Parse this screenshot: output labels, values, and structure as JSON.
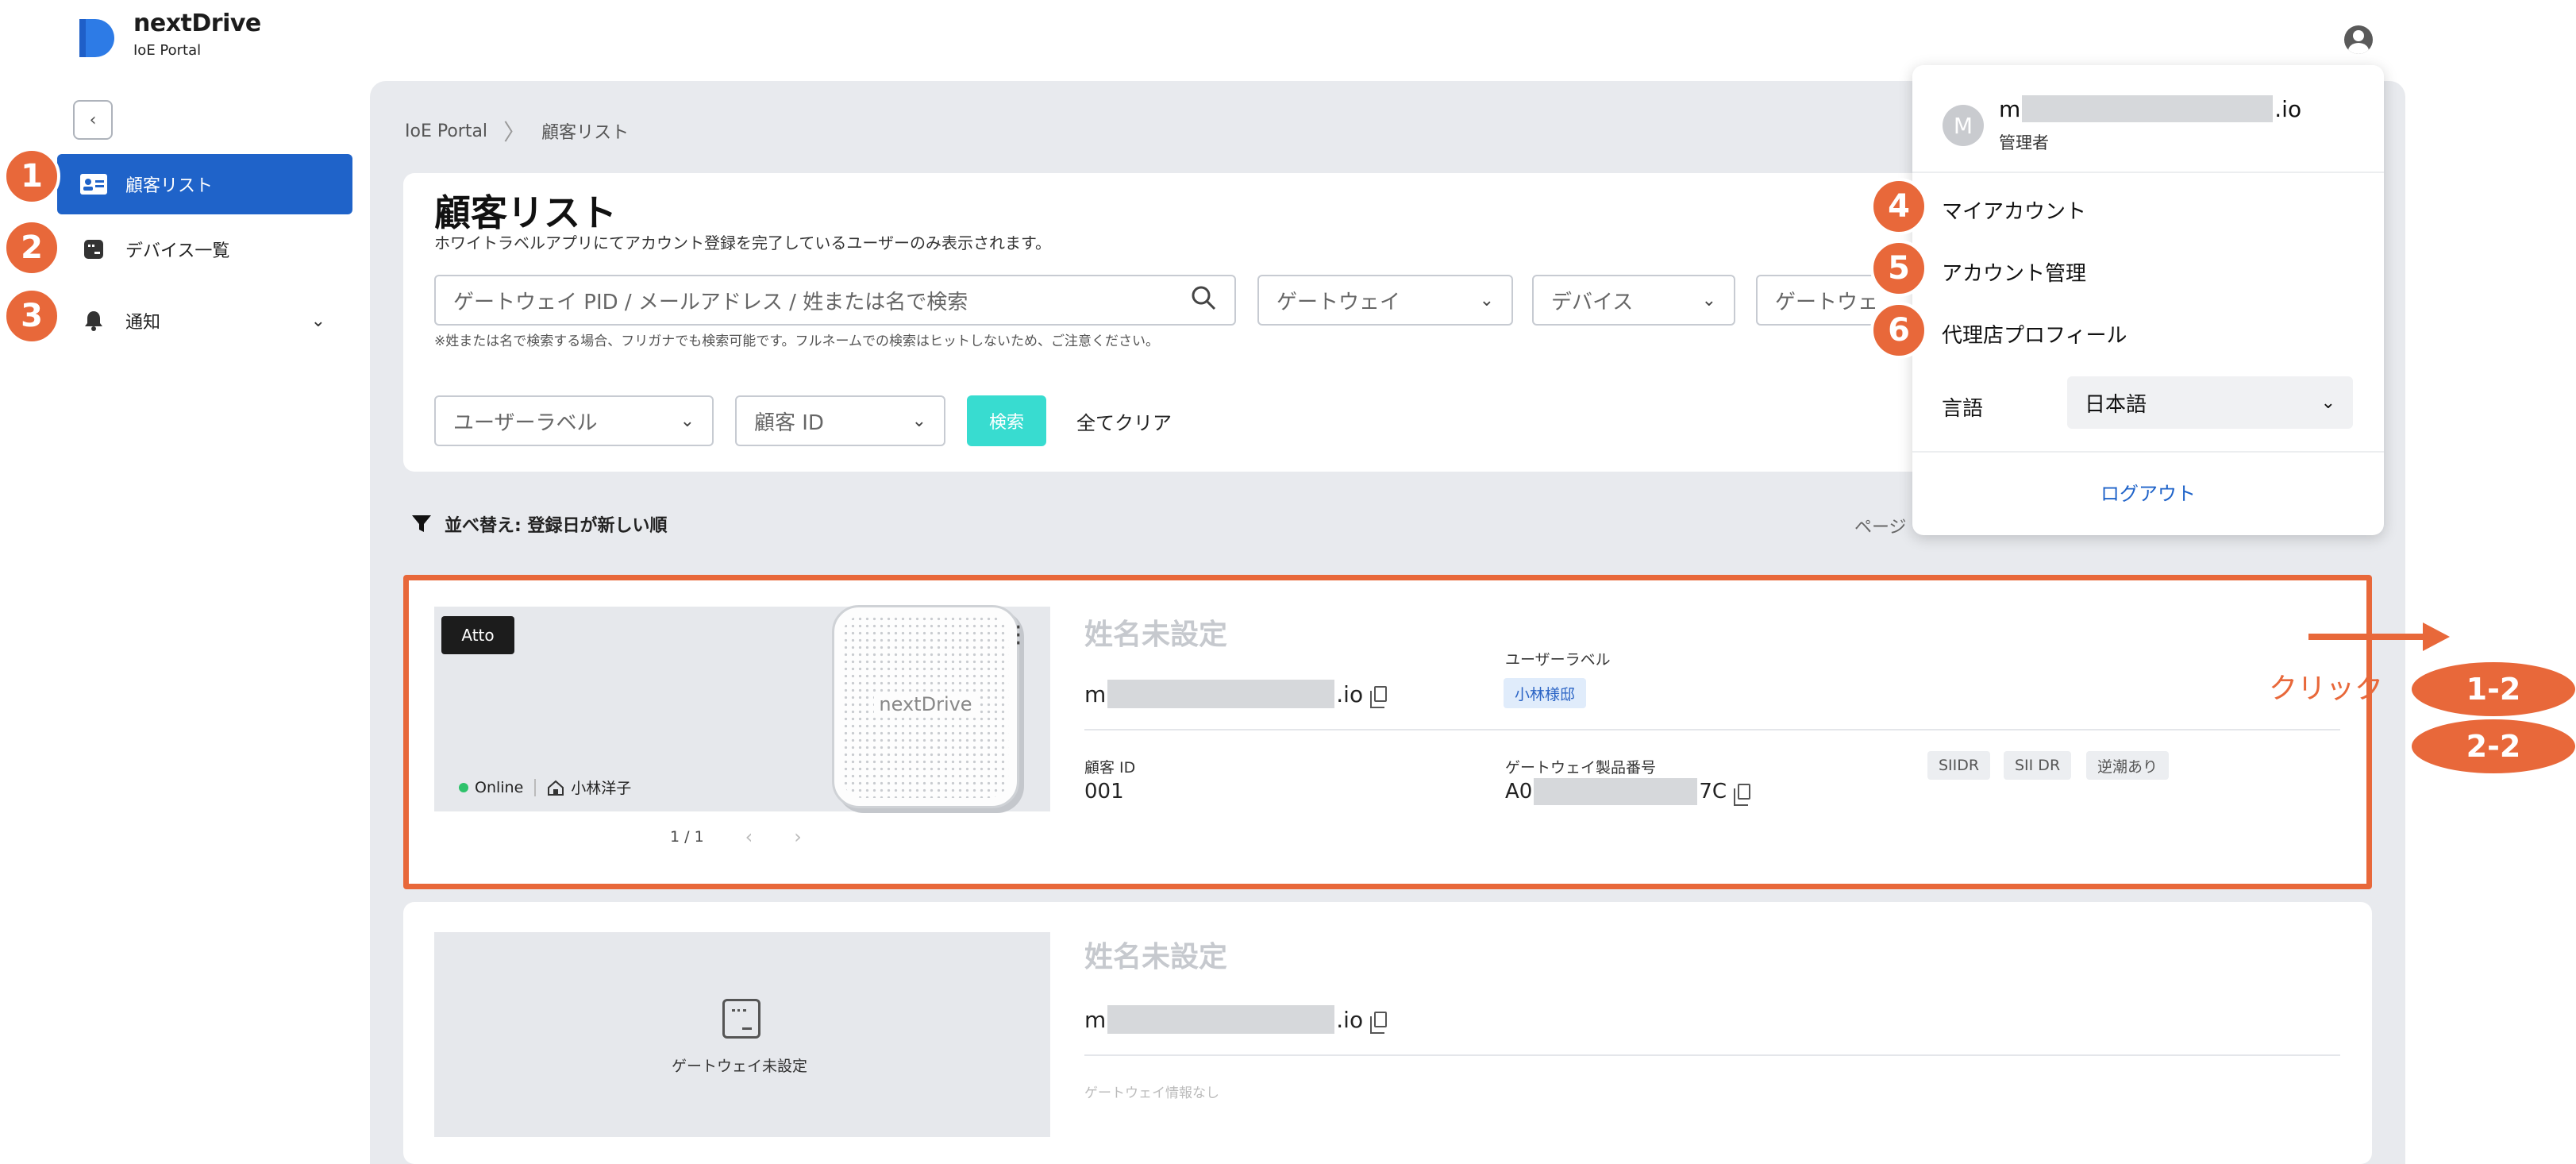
{
  "app": {
    "name": "nextDrive",
    "subtitle": "IoE Portal"
  },
  "sidebar": {
    "collapse_symbol": "‹",
    "items": [
      {
        "label": "顧客リスト",
        "badge": "1",
        "active": true
      },
      {
        "label": "デバイス一覧",
        "badge": "2",
        "active": false
      },
      {
        "label": "通知",
        "badge": "3",
        "active": false,
        "expand_symbol": "⌄"
      }
    ]
  },
  "breadcrumb": {
    "root": "IoE Portal",
    "separator": "〉",
    "current": "顧客リスト"
  },
  "page": {
    "title": "顧客リスト",
    "description": "ホワイトラベルアプリにてアカウント登録を完了しているユーザーのみ表示されます。"
  },
  "filters": {
    "search_placeholder": "ゲートウェイ PID / メールアドレス / 姓または名で検索",
    "gateway": "ゲートウェイ",
    "device": "デバイス",
    "gateway_status": "ゲートウェ",
    "hint": "※姓または名で検索する場合、フリガナでも検索可能です。フルネームでの検索はヒットしないため、ご注意ください。",
    "user_label": "ユーザーラベル",
    "customer_id": "顧客 ID",
    "search_button": "検索",
    "clear_button": "全てクリア",
    "dropdown_symbol": "⌄"
  },
  "sort": {
    "label": "並べ替え: 登録日が新しい順"
  },
  "pagination": {
    "label": "ページ"
  },
  "customers": [
    {
      "model": "Atto",
      "device_brand": "nextDrive",
      "status": "Online",
      "owner": "小林洋子",
      "pager": "1 / 1",
      "pager_prev": "‹",
      "pager_next": "›",
      "name": "姓名未設定",
      "email_start": "m",
      "email_end": ".io",
      "user_label_title": "ユーザーラベル",
      "user_label": "小林様邸",
      "customer_id_title": "顧客 ID",
      "customer_id": "001",
      "gateway_serial_title": "ゲートウェイ製品番号",
      "gateway_serial_start": "A0",
      "gateway_serial_end": "7C",
      "tags": [
        "SIIDR",
        "SII DR",
        "逆潮あり"
      ]
    },
    {
      "name": "姓名未設定",
      "email_start": "m",
      "email_end": ".io",
      "gateway_unset": "ゲートウェイ未設定",
      "gateway_none": "ゲートウェイ情報なし"
    }
  ],
  "annotation": {
    "click": "クリック",
    "labels": [
      "1-2",
      "2-2"
    ]
  },
  "user_menu": {
    "avatar_letter": "M",
    "email_start": "m",
    "email_end": ".io",
    "role": "管理者",
    "items": [
      {
        "label": "マイアカウント",
        "badge": "4"
      },
      {
        "label": "アカウント管理",
        "badge": "5"
      },
      {
        "label": "代理店プロフィール",
        "badge": "6"
      }
    ],
    "language_label": "言語",
    "language_value": "日本語",
    "logout": "ログアウト"
  },
  "colors": {
    "primary": "#1f63c9",
    "accent": "#e8683a",
    "search": "#38dcd0",
    "online": "#2ec26b"
  }
}
